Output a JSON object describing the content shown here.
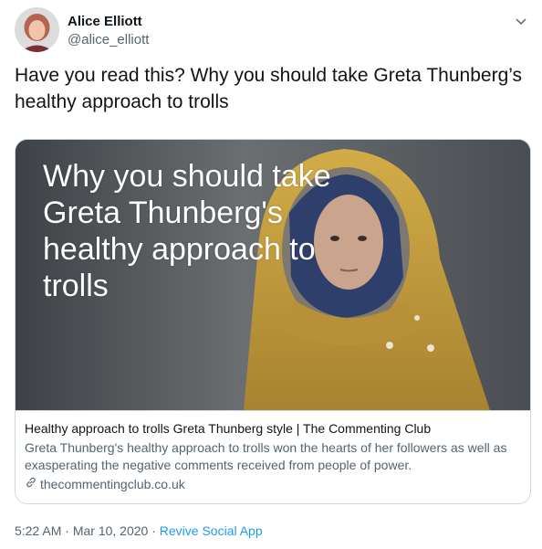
{
  "author": {
    "name": "Alice Elliott",
    "handle": "@alice_elliott"
  },
  "tweet": {
    "text": "Have you read this?  Why you should take Greta Thunberg’s healthy approach to trolls"
  },
  "card": {
    "image_overlay_text": "Why you should take Greta Thunberg's healthy approach to trolls",
    "title": "Healthy approach to trolls Greta Thunberg style | The Commenting Club",
    "description": "Greta Thunberg's healthy approach to trolls won the hearts of her followers as well as exasperating the negative comments received from people of power.",
    "domain": "thecommentingclub.co.uk"
  },
  "meta": {
    "time": "5:22 AM",
    "separator": "·",
    "date": "Mar 10, 2020",
    "source": "Revive Social App"
  },
  "icons": {
    "more": "chevron-down-icon",
    "link": "link-icon"
  },
  "colors": {
    "link_blue": "#1d9bf0",
    "secondary_text": "#536471",
    "jacket_yellow": "#c9a13c"
  }
}
